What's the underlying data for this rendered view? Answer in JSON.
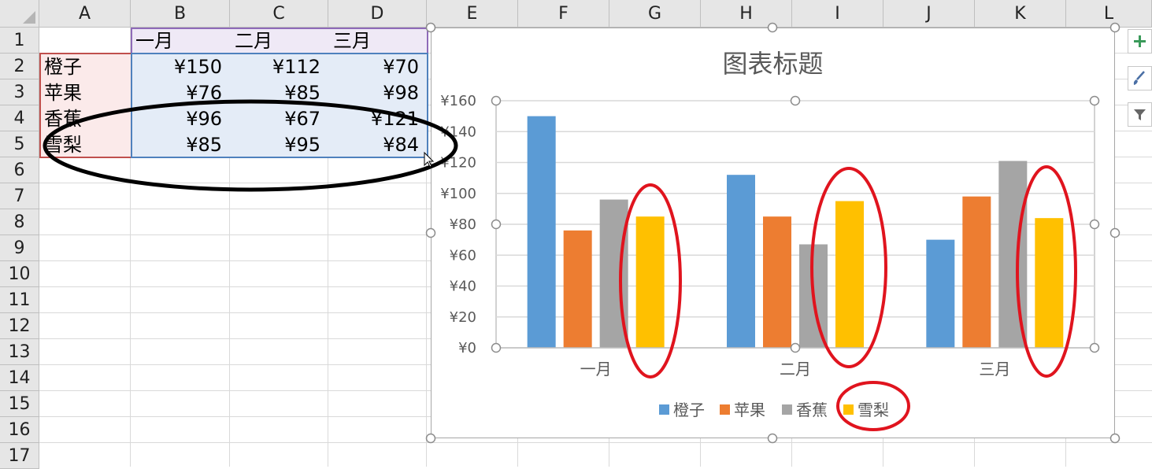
{
  "columns": [
    "A",
    "B",
    "C",
    "D",
    "E",
    "F",
    "G",
    "H",
    "I",
    "J",
    "K",
    "L"
  ],
  "rows": [
    "1",
    "2",
    "3",
    "4",
    "5",
    "6",
    "7",
    "8",
    "9",
    "10",
    "11",
    "12",
    "13",
    "14",
    "15",
    "16",
    "17"
  ],
  "sheet": {
    "header_row": [
      "一月",
      "二月",
      "三月"
    ],
    "data_rows": [
      {
        "label": "橙子",
        "values": [
          "¥150",
          "¥112",
          "¥70"
        ]
      },
      {
        "label": "苹果",
        "values": [
          "¥76",
          "¥85",
          "¥98"
        ]
      },
      {
        "label": "香蕉",
        "values": [
          "¥96",
          "¥67",
          "¥121"
        ]
      },
      {
        "label": "雪梨",
        "values": [
          "¥85",
          "¥95",
          "¥84"
        ]
      }
    ]
  },
  "chart_data": {
    "type": "bar",
    "title": "图表标题",
    "categories": [
      "一月",
      "二月",
      "三月"
    ],
    "series": [
      {
        "name": "橙子",
        "values": [
          150,
          112,
          70
        ],
        "color": "#5b9bd5"
      },
      {
        "name": "苹果",
        "values": [
          76,
          85,
          98
        ],
        "color": "#ed7d31"
      },
      {
        "name": "香蕉",
        "values": [
          96,
          67,
          121
        ],
        "color": "#a5a5a5"
      },
      {
        "name": "雪梨",
        "values": [
          85,
          95,
          84
        ],
        "color": "#ffc000"
      }
    ],
    "ylim": [
      0,
      160
    ],
    "yticks": [
      "¥0",
      "¥20",
      "¥40",
      "¥60",
      "¥80",
      "¥100",
      "¥120",
      "¥140",
      "¥160"
    ],
    "grid": true,
    "legend": "bottom"
  },
  "annotations": {
    "table_ellipse_color": "#000000",
    "highlight_ellipse_color": "#e0141e"
  },
  "colors": {
    "header_fill": "#e6e6e6",
    "gridline": "#d9d9d9"
  },
  "side_buttons": [
    "plus-icon",
    "brush-icon",
    "filter-icon"
  ]
}
